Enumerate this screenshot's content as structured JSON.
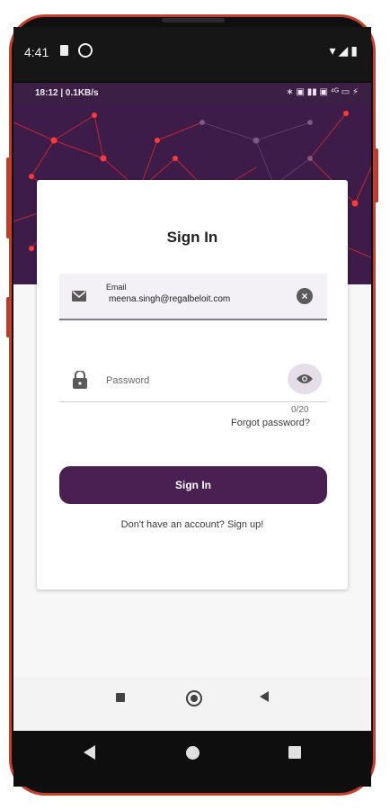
{
  "outer_status": {
    "time": "4:41",
    "icons": "▾◢▮"
  },
  "inner_status": {
    "left": "18:12 | 0.1KB/s",
    "right": "∗ ▣ ▮▮ ▣ ⁴ᴳ ▭ ⚡"
  },
  "signin": {
    "title": "Sign In",
    "email_label": "Email",
    "email_value": "meena.singh@regalbeloit.com",
    "clear_glyph": "×",
    "password_placeholder": "Password",
    "password_counter": "0/20",
    "forgot_password": "Forgot password?",
    "signin_button": "Sign In",
    "signup_prompt": "Don't have an account? Sign up!"
  },
  "colors": {
    "primary": "#4a1f52",
    "hero": "#3d1c4a",
    "frame": "#c2402e"
  },
  "icons": [
    "mail-icon",
    "clear-icon",
    "lock-icon",
    "eye-icon",
    "nav-recents-icon",
    "nav-home-icon",
    "nav-back-icon"
  ]
}
